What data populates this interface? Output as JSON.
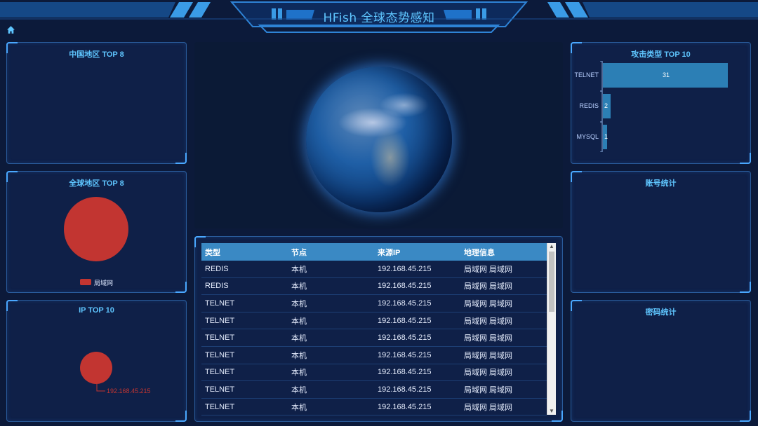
{
  "app": {
    "title": "HFish 全球态势感知"
  },
  "panels": {
    "china_top8": {
      "title": "中国地区 TOP 8"
    },
    "global_top8": {
      "title": "全球地区 TOP 8",
      "legend": "局域网"
    },
    "ip_top10": {
      "title": "IP TOP 10",
      "label": "192.168.45.215"
    },
    "attack_types": {
      "title": "攻击类型 TOP 10"
    },
    "accounts": {
      "title": "账号统计"
    },
    "passwords": {
      "title": "密码统计"
    }
  },
  "table": {
    "headers": [
      "类型",
      "节点",
      "来源IP",
      "地理信息"
    ],
    "rows": [
      [
        "REDIS",
        "本机",
        "192.168.45.215",
        "局域网 局域网"
      ],
      [
        "REDIS",
        "本机",
        "192.168.45.215",
        "局域网 局域网"
      ],
      [
        "TELNET",
        "本机",
        "192.168.45.215",
        "局域网 局域网"
      ],
      [
        "TELNET",
        "本机",
        "192.168.45.215",
        "局域网 局域网"
      ],
      [
        "TELNET",
        "本机",
        "192.168.45.215",
        "局域网 局域网"
      ],
      [
        "TELNET",
        "本机",
        "192.168.45.215",
        "局域网 局域网"
      ],
      [
        "TELNET",
        "本机",
        "192.168.45.215",
        "局域网 局域网"
      ],
      [
        "TELNET",
        "本机",
        "192.168.45.215",
        "局域网 局域网"
      ],
      [
        "TELNET",
        "本机",
        "192.168.45.215",
        "局域网 局域网"
      ]
    ]
  },
  "chart_data": [
    {
      "type": "bar",
      "orientation": "horizontal",
      "categories": [
        "TELNET",
        "REDIS",
        "MYSQL"
      ],
      "values": [
        31,
        2,
        1
      ]
    },
    {
      "type": "pie",
      "categories": [
        "局域网"
      ],
      "values": [
        1
      ],
      "colors": [
        "#c23531"
      ]
    },
    {
      "type": "pie",
      "categories": [
        "192.168.45.215"
      ],
      "values": [
        1
      ],
      "colors": [
        "#c23531"
      ]
    }
  ],
  "colors": {
    "accent": "#5fc6ff",
    "bar": "#2c7fb5",
    "pie": "#c23531",
    "background": "#0c1a3a"
  }
}
